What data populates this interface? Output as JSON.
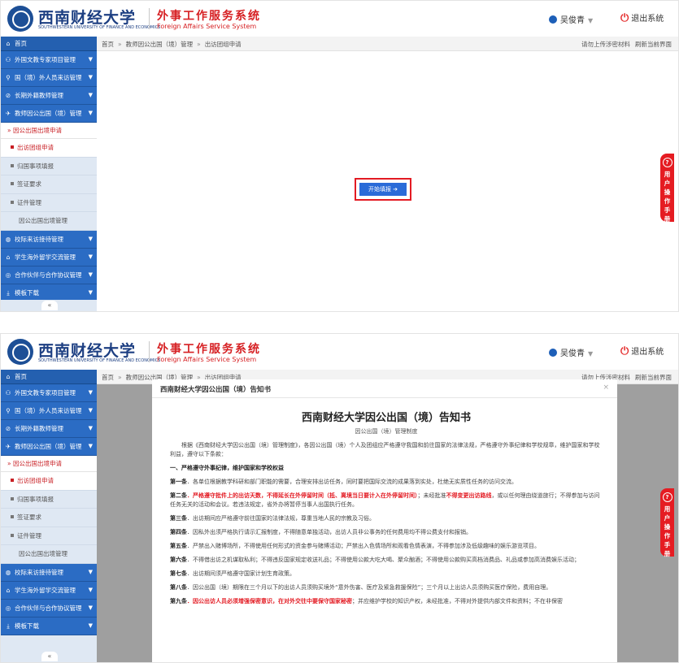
{
  "header": {
    "university_cn": "西南财经大学",
    "university_en": "SOUTHWESTERN UNIVERSITY OF FINANCE AND ECONOMICS",
    "system_cn": "外事工作服务系统",
    "system_en": "Foreign Affairs Service System",
    "user_name": "吴俊青",
    "logout_label": "退出系统"
  },
  "breadcrumb": {
    "items": [
      "首页",
      "教师因公出国（境）管理",
      "出访团组申请"
    ],
    "separator": "»",
    "right_links": [
      "请勿上传涉密材料",
      "刷新当前界面"
    ]
  },
  "sidebar": {
    "home": "首页",
    "groups_top": [
      "外国文教专家项目管理",
      "国（境）外人员来访管理",
      "长期外籍教师管理",
      "教师因公出国（境）管理"
    ],
    "sub_header": "因公出国出境申请",
    "items": [
      "出访团组申请",
      "归国事项填报",
      "签证要求",
      "证件管理"
    ],
    "plain_item": "因公出国出境管理",
    "groups_bottom": [
      "校际来访接待管理",
      "学生海外留学交流管理",
      "合作伙伴与合作协议管理",
      "模板下载"
    ],
    "collapse_icon": "«"
  },
  "main": {
    "start_button": "开始填报 ➔"
  },
  "manual_tab": {
    "icon": "?",
    "chars": [
      "用",
      "户",
      "操",
      "作",
      "手",
      "册"
    ]
  },
  "modal": {
    "title": "西南财经大学因公出国（境）告知书",
    "close": "×",
    "doc_title": "西南财经大学因公出国（境）告知书",
    "doc_sub": "因公出国（境）管理制度",
    "intro": "根据《西南财经大学因公出国（境）管理制度》，各因公出国（境）个人及团组应严格遵守我国和前往国家的法律法规，严格遵守外事纪律和学校规章，维护国家和学校利益，遵守以下条款：",
    "section1": "一、严格遵守外事纪律，维护国家和学校权益",
    "a1_label": "第一条",
    "a1_text": "．各单位根据教学科研和部门职能的需要，合理安排出访任务，同时要把国际交流的成果落到实处，杜绝无实质性任务的访问交流。",
    "a2_label": "第二条",
    "a2_red1": "．严格遵守批件上的出访天数，不得延长在外停留时间（抵、离境当日要计入在外停留时间）",
    "a2_mid": "；未经批准",
    "a2_red2": "不得变更出访路线",
    "a2_rest": "，或以任何理由绕道旅行；不得参加与访问任务无关的活动和会议。若违法规定，省外办将暂停当事人出国执行任务。",
    "a3_label": "第三条",
    "a3_text": "．出访期间应严格遵守前往国家的法律法规，尊重当地人民的宗教及习俗。",
    "a4_label": "第四条",
    "a4_text": "．因私外出须严格执行请示汇报制度，不得随意单独活动，出访人员非公事务的任何费用均不得公费支付和报销。",
    "a5_label": "第五条",
    "a5_text": "．严禁出入赌博场所，不得使用任何形式的资金参与赌博活动；严禁出入色情场所和观看色情表演，不得参加涉及低级趣味的娱乐游览项目。",
    "a6_label": "第六条",
    "a6_text": "．不得借出访之机谋取私利；不得违反国家规定收送礼品；不得使用公款大吃大喝、聚众酗酒；不得使用公款购买高档消费品、礼品或参加高消费娱乐活动；",
    "a7_label": "第七条",
    "a7_text": "．出访期间须严格遵守国家计划生育政策。",
    "a8_label": "第八条",
    "a8_text": "．因公出国（境）期限在三个月以下的出访人员须购买境外“意外伤害、医疗及紧急救援保险”；三个月以上出访人员须购买医疗保险，费用自理。",
    "a9_label": "第九条",
    "a9_red": "．因公出访人员必须增强保密意识，在对外交往中要保守国家秘密",
    "a9_rest": "；并应维护学校的知识产权，未经批准，不得对外提供内部文件和资料；不在非保密"
  }
}
